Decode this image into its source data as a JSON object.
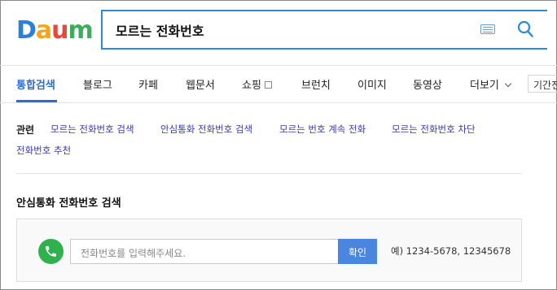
{
  "logo": {
    "letters": [
      "D",
      "a",
      "u",
      "m"
    ],
    "colors": [
      "#2b7fd8",
      "#f2a51a",
      "#e5493a",
      "#3cae5b"
    ]
  },
  "search": {
    "value": "모르는 전화번호"
  },
  "tabs": [
    {
      "label": "통합검색",
      "active": true
    },
    {
      "label": "블로그"
    },
    {
      "label": "카페"
    },
    {
      "label": "웹문서"
    },
    {
      "label": "쇼핑"
    },
    {
      "label": "브런치"
    },
    {
      "label": "이미지"
    },
    {
      "label": "동영상"
    },
    {
      "label": "더보기"
    }
  ],
  "period_button": "기간전체",
  "related": {
    "title": "관련",
    "items": [
      "모르는 전화번호 검색",
      "안심통화 전화번호 검색",
      "모르는 번호 계속 전화",
      "모르는 전화번호 차단",
      "전화번호 추천"
    ]
  },
  "safe_call": {
    "title": "안심통화 전화번호 검색",
    "placeholder": "전화번호를 입력해주세요.",
    "button": "확인",
    "example": "예) 1234-5678, 12345678"
  },
  "colors": {
    "accent": "#2a6fd0",
    "search_border": "#2a8bd8",
    "link": "#3a3aa8",
    "phone_green": "#2fb14d",
    "button_blue": "#4a86e0"
  }
}
